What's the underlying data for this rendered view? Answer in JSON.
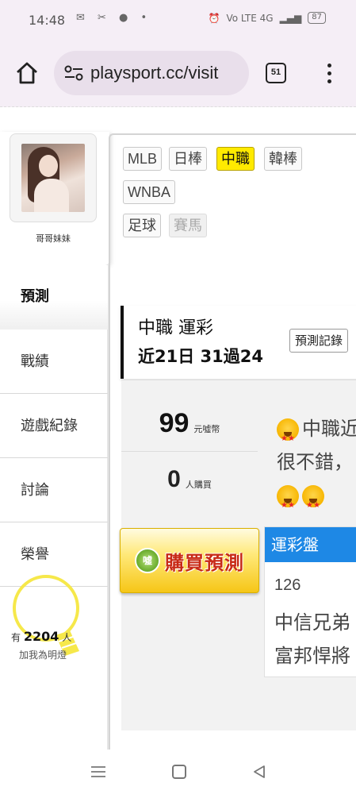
{
  "status_bar": {
    "time": "14:48",
    "left_icons": "✉ ✂ ● •",
    "network": "Vo LTE 4G",
    "battery": "87"
  },
  "browser": {
    "url": "playsport.cc/visit",
    "tab_count": "51"
  },
  "profile": {
    "username": "哥哥妹妹"
  },
  "sidebar": {
    "items": [
      {
        "label": "預測"
      },
      {
        "label": "戰績"
      },
      {
        "label": "遊戲紀錄"
      },
      {
        "label": "討論"
      },
      {
        "label": "榮譽"
      }
    ],
    "lightbulb": {
      "prefix": "有",
      "count": "2204",
      "suffix": "人",
      "caption": "加我為明燈"
    }
  },
  "leagues": [
    {
      "label": "MLB",
      "state": "normal"
    },
    {
      "label": "日棒",
      "state": "normal"
    },
    {
      "label": "中職",
      "state": "active"
    },
    {
      "label": "韓棒",
      "state": "normal"
    },
    {
      "label": "WNBA",
      "state": "normal"
    },
    {
      "label": "足球",
      "state": "normal"
    },
    {
      "label": "賽馬",
      "state": "disabled"
    }
  ],
  "prediction": {
    "title": "中職 運彩",
    "record": "近21日 31過24",
    "history_button": "預測記錄",
    "price": "99",
    "price_unit": "元噓幣",
    "buyers": "0",
    "buyers_unit": "人購買",
    "desc_line1": "中職近",
    "desc_line2": "很不錯，",
    "buy_button": "購買預測",
    "coin_label": "噓",
    "table_header": "運彩盤",
    "game_number": "126",
    "team_away": "中信兄弟",
    "team_home": "富邦悍將"
  },
  "colors": {
    "active_league": "#ffea00",
    "table_header": "#1e88e5",
    "buy_text": "#c82a16"
  }
}
